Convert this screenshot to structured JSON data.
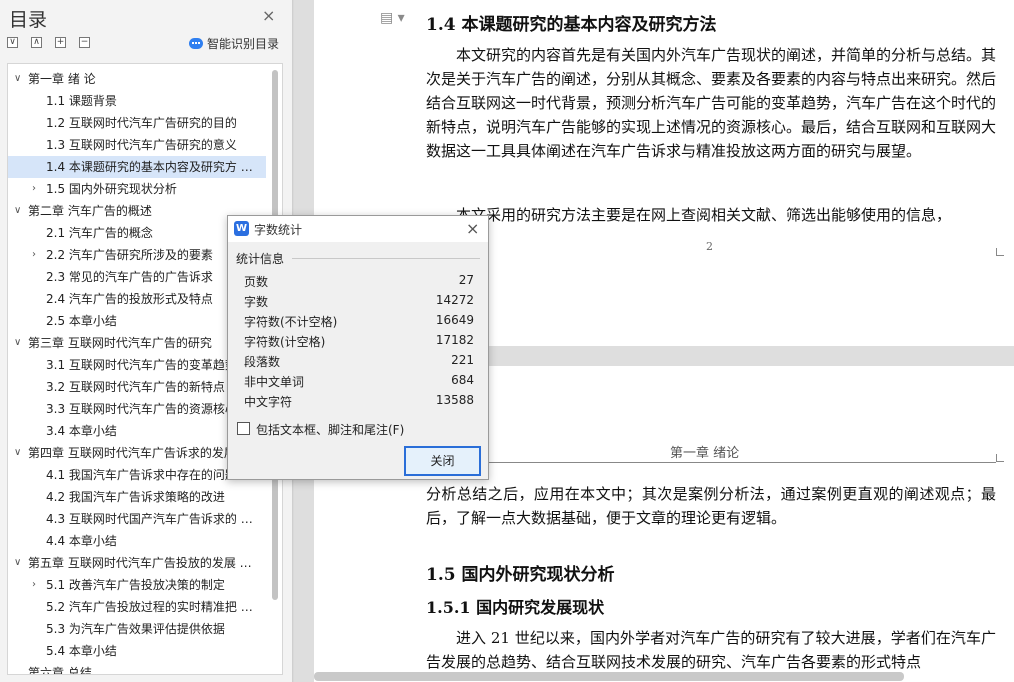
{
  "sidebar": {
    "title": "目录",
    "close_glyph": "×",
    "tools": [
      "∨",
      "∧",
      "+",
      "−"
    ],
    "ai_toc_label": "智能识别目录",
    "items": [
      {
        "label": "第一章  绪  论",
        "level": 0,
        "chevron": "∨",
        "active": false
      },
      {
        "label": "1.1  课题背景",
        "level": 1,
        "chevron": "",
        "active": false
      },
      {
        "label": "1.2  互联网时代汽车广告研究的目的",
        "level": 1,
        "chevron": "",
        "active": false
      },
      {
        "label": "1.3  互联网时代汽车广告研究的意义",
        "level": 1,
        "chevron": "",
        "active": false
      },
      {
        "label": "1.4  本课题研究的基本内容及研究方 …",
        "level": 1,
        "chevron": "",
        "active": true
      },
      {
        "label": "1.5  国内外研究现状分析",
        "level": 1,
        "chevron": "›",
        "active": false
      },
      {
        "label": "第二章  汽车广告的概述",
        "level": 0,
        "chevron": "∨",
        "active": false
      },
      {
        "label": "2.1  汽车广告的概念",
        "level": 1,
        "chevron": "",
        "active": false
      },
      {
        "label": "2.2  汽车广告研究所涉及的要素",
        "level": 1,
        "chevron": "›",
        "active": false
      },
      {
        "label": "2.3  常见的汽车广告的广告诉求",
        "level": 1,
        "chevron": "",
        "active": false
      },
      {
        "label": "2.4  汽车广告的投放形式及特点",
        "level": 1,
        "chevron": "",
        "active": false
      },
      {
        "label": "2.5  本章小结",
        "level": 1,
        "chevron": "",
        "active": false
      },
      {
        "label": "第三章  互联网时代汽车广告的研究",
        "level": 0,
        "chevron": "∨",
        "active": false
      },
      {
        "label": "3.1  互联网时代汽车广告的变革趋势",
        "level": 1,
        "chevron": "",
        "active": false
      },
      {
        "label": "3.2  互联网时代汽车广告的新特点",
        "level": 1,
        "chevron": "",
        "active": false
      },
      {
        "label": "3.3  互联网时代汽车广告的资源核心",
        "level": 1,
        "chevron": "",
        "active": false
      },
      {
        "label": "3.4  本章小结",
        "level": 1,
        "chevron": "",
        "active": false
      },
      {
        "label": "第四章  互联网时代汽车广告诉求的发展",
        "level": 0,
        "chevron": "∨",
        "active": false
      },
      {
        "label": "4.1  我国汽车广告诉求中存在的问题",
        "level": 1,
        "chevron": "",
        "active": false
      },
      {
        "label": "4.2  我国汽车广告诉求策略的改进",
        "level": 1,
        "chevron": "",
        "active": false
      },
      {
        "label": "4.3  互联网时代国产汽车广告诉求的 …",
        "level": 1,
        "chevron": "",
        "active": false
      },
      {
        "label": "4.4  本章小结",
        "level": 1,
        "chevron": "",
        "active": false
      },
      {
        "label": "第五章  互联网时代汽车广告投放的发展 …",
        "level": 0,
        "chevron": "∨",
        "active": false
      },
      {
        "label": "5.1  改善汽车广告投放决策的制定",
        "level": 1,
        "chevron": "›",
        "active": false
      },
      {
        "label": "5.2  汽车广告投放过程的实时精准把 …",
        "level": 1,
        "chevron": "",
        "active": false
      },
      {
        "label": "5.3  为汽车广告效果评估提供依据",
        "level": 1,
        "chevron": "",
        "active": false
      },
      {
        "label": "5.4  本章小结",
        "level": 1,
        "chevron": "",
        "active": false
      },
      {
        "label": "第六章  总结",
        "level": 0,
        "chevron": "",
        "active": false
      }
    ]
  },
  "document": {
    "page1": {
      "heading": "1.4  本课题研究的基本内容及研究方法",
      "para1": "本文研究的内容首先是有关国内外汽车广告现状的阐述，并简单的分析与总结。其次是关于汽车广告的阐述，分别从其概念、要素及各要素的内容与特点出来研究。然后结合互联网这一时代背景，预测分析汽车广告可能的变革趋势，汽车广告在这个时代的新特点，说明汽车广告能够的实现上述情况的资源核心。最后，结合互联网和互联网大数据这一工具具体阐述在汽车广告诉求与精准投放这两方面的研究与展望。",
      "para2": "本文采用的研究方法主要是在网上查阅相关文献、筛选出能够使用的信息，",
      "page_number": "2"
    },
    "page2": {
      "header": "第一章  绪论",
      "para_cont": "分析总结之后，应用在本文中；其次是案例分析法，通过案例更直观的阐述观点；最后，了解一点大数据基础，便于文章的理论更有逻辑。",
      "heading15": "1.5  国内外研究现状分析",
      "heading151": "1.5.1  国内研究发展现状",
      "para3": "进入 21 世纪以来，国内外学者对汽车广告的研究有了较大进展，学者们在汽车广告发展的总趋势、结合互联网技术发展的研究、汽车广告各要素的形式特点"
    }
  },
  "dialog": {
    "logo": "W",
    "title": "字数统计",
    "close_glyph": "×",
    "section": "统计信息",
    "stats": [
      {
        "label": "页数",
        "value": "27"
      },
      {
        "label": "字数",
        "value": "14272"
      },
      {
        "label": "字符数(不计空格)",
        "value": "16649"
      },
      {
        "label": "字符数(计空格)",
        "value": "17182"
      },
      {
        "label": "段落数",
        "value": "221"
      },
      {
        "label": "非中文单词",
        "value": "684"
      },
      {
        "label": "中文字符",
        "value": "13588"
      }
    ],
    "checkbox_label": "包括文本框、脚注和尾注(F)",
    "checkbox_checked": false,
    "close_button": "关闭"
  }
}
